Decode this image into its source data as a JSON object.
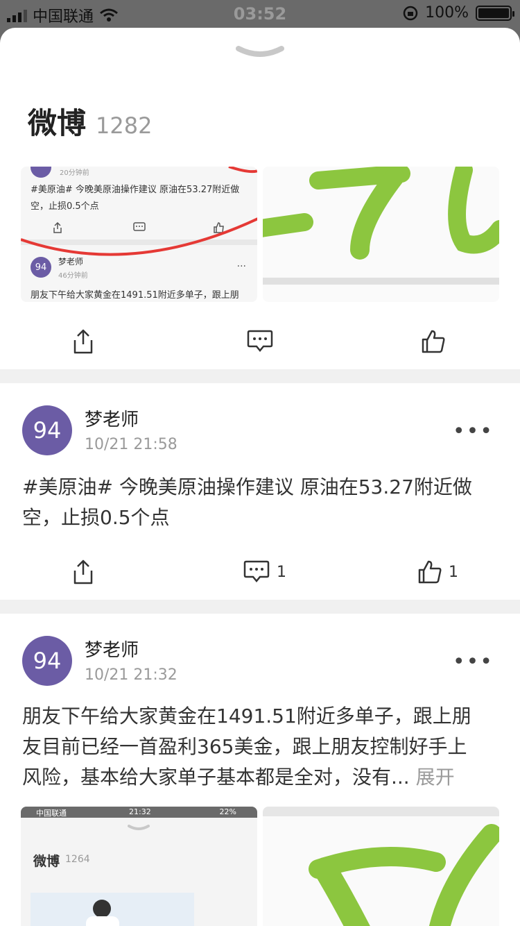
{
  "status": {
    "carrier": "中国联通",
    "time": "03:52",
    "battery": "100%"
  },
  "header": {
    "title": "微博",
    "count": "1282"
  },
  "mini1": {
    "time1": "20分钟前",
    "text1": "#美原油# 今晚美原油操作建议 原油在53.27附近做",
    "text1b": "空，止损0.5个点",
    "avatar": "94",
    "name": "梦老师",
    "time2": "46分钟前",
    "text2": "朋友下午给大家黄金在1491.51附近多单子，跟上朋"
  },
  "posts": [
    {
      "avatar": "94",
      "name": "梦老师",
      "time": "10/21 21:58",
      "line1": "#美原油# 今晚美原油操作建议 原油在53.27附近做",
      "line2": "空，止损0.5个点",
      "comments": "1",
      "likes": "1"
    },
    {
      "avatar": "94",
      "name": "梦老师",
      "time": "10/21 21:32",
      "line1": "朋友下午给大家黄金在1491.51附近多单子，跟上朋",
      "line2": "友目前已经一首盈利365美金，跟上朋友控制好手上",
      "line3": "风险，基本给大家单子基本都是全对，没有...",
      "expand": "展开"
    }
  ],
  "mini2": {
    "carrier": "中国联通",
    "time": "21:32",
    "battery": "22%",
    "title": "微博",
    "count": "1264"
  },
  "colors": {
    "avatar": "#6b5ca5",
    "green": "#8cc63f",
    "red": "#e53935"
  }
}
